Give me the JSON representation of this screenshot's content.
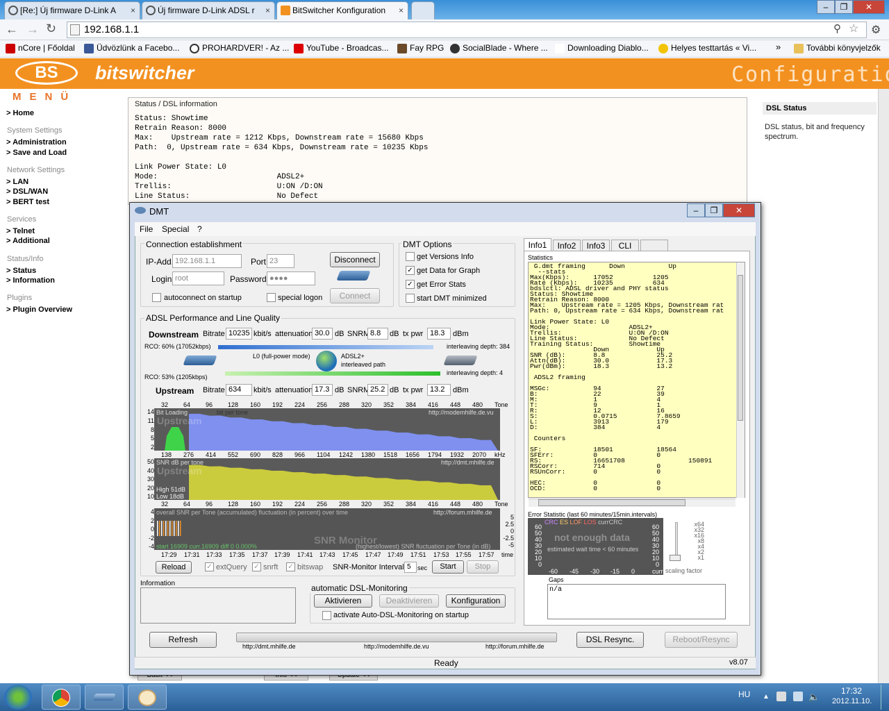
{
  "browser": {
    "tabs": [
      {
        "label": "[Re:] Új firmware D-Link A"
      },
      {
        "label": "Új firmware D-Link ADSL r"
      },
      {
        "label": "BitSwitcher Konfiguration"
      }
    ],
    "url": "192.168.1.1",
    "bookmarks": [
      {
        "label": "nCore | Főoldal"
      },
      {
        "label": "Üdvözlünk a Facebo..."
      },
      {
        "label": "PROHARDVER! - Az ..."
      },
      {
        "label": "YouTube - Broadcas..."
      },
      {
        "label": "Fay RPG"
      },
      {
        "label": "SocialBlade - Where ..."
      },
      {
        "label": "Downloading Diablo..."
      },
      {
        "label": "Helyes testtartás « Vi..."
      },
      {
        "label": "További könyvjelzők"
      }
    ]
  },
  "page": {
    "logo": "BS",
    "brand": "bitswitcher",
    "header_title": "Configuration",
    "menu_title": "MENÜ",
    "nav": {
      "home": "> Home",
      "system_settings": "System Settings",
      "administration": "> Administration",
      "save_load": "> Save and Load",
      "network_settings": "Network Settings",
      "lan": "> LAN",
      "dsl_wan": "> DSL/WAN",
      "bert": "> BERT test",
      "services": "Services",
      "telnet": "> Telnet",
      "additional": "> Additional",
      "status_info": "Status/Info",
      "status": "> Status",
      "information": "> Information",
      "plugins": "Plugins",
      "plugin_overview": "> Plugin Overview"
    },
    "status_heading": "Status / DSL information",
    "status_lines": "Status: Showtime\nRetrain Reason: 8000\nMax:    Upstream rate = 1212 Kbps, Downstream rate = 15680 Kbps\nPath:  0, Upstream rate = 634 Kbps, Downstream rate = 10235 Kbps\n\nLink Power State: L0\nMode:                          ADSL2+\nTrellis:                       U:ON /D:ON\nLine Status:                   No Defect",
    "right_heading": "DSL Status",
    "right_desc": "DSL status, bit and frequency spectrum.",
    "bottom_buttons": [
      "Back <<",
      "Info <<",
      "Update <<"
    ]
  },
  "dmt": {
    "title": "DMT",
    "menu": [
      "File",
      "Special",
      "?"
    ],
    "connection": {
      "group": "Connection establishment",
      "ip_label": "IP-Add.",
      "ip_value": "192.168.1.1",
      "port_label": "Port",
      "port_value": "23",
      "login_label": "Login",
      "login_value": "root",
      "password_label": "Password",
      "password_value": "●●●●",
      "disconnect": "Disconnect",
      "connect": "Connect",
      "autoconnect": "autoconnect on startup",
      "special_logon": "special logon"
    },
    "options": {
      "group": "DMT Options",
      "versions": "get Versions Info",
      "data_graph": "get Data for Graph",
      "error_stats": "get Error Stats",
      "minimized": "start DMT minimized"
    },
    "perf": {
      "group": "ADSL Performance and Line Quality",
      "downstream": "Downstream",
      "upstream": "Upstream",
      "bitrate": "Bitrate",
      "kbits": "kbit/s",
      "attenuation": "attenuation",
      "db": "dB",
      "snrm": "SNRM",
      "txpwr": "tx pwr",
      "dbm": "dBm",
      "down_bitrate": "10235",
      "down_att": "30.0",
      "down_snrm": "8.8",
      "down_txpwr": "18.3",
      "up_bitrate": "634",
      "up_att": "17.3",
      "up_snrm": "25.2",
      "up_txpwr": "13.2",
      "rco_down": "RCO: 60% (17052kbps)",
      "rco_up": "RCO: 53% (1205kbps)",
      "power_mode": "L0 (full-power mode)",
      "adsl_mode": "ADSL2+",
      "path": "interleaved path",
      "il_down": "interleaving depth: 384",
      "il_up": "interleaving depth: 4"
    },
    "charts": {
      "tone_ticks": [
        "32",
        "64",
        "96",
        "128",
        "160",
        "192",
        "224",
        "256",
        "288",
        "320",
        "352",
        "384",
        "416",
        "448",
        "480",
        "Tone"
      ],
      "khz_ticks": [
        "138",
        "276",
        "414",
        "552",
        "690",
        "828",
        "966",
        "1104",
        "1242",
        "1380",
        "1518",
        "1656",
        "1794",
        "1932",
        "2070",
        "kHz"
      ],
      "time_ticks": [
        "17:29",
        "17:31",
        "17:33",
        "17:35",
        "17:37",
        "17:39",
        "17:41",
        "17:43",
        "17:45",
        "17:47",
        "17:49",
        "17:51",
        "17:53",
        "17:55",
        "17:57",
        "time"
      ],
      "bit_label": "Bit Loading",
      "bit_sub": "bit per tone",
      "bit_url": "http://modemhilfe.de.vu",
      "bit_watermark": "Upstream",
      "snr_label": "SNR  dB per tone",
      "snr_url": "http://dmt.mhilfe.de",
      "snr_watermark": "Upstream",
      "snr_high": "High 51dB",
      "snr_low": "Low  18dB",
      "mon_label": "overall SNR per Tone (accumulated) fluctuation (in percent) over time",
      "mon_url": "http://forum.mhilfe.de",
      "mon_watermark": "SNR Monitor",
      "mon_footer": "start 16909  curr.16909  diff   0          0.000%",
      "mon_footer2": "(highest/lowest) SNR fluctuation per Tone (in dB)",
      "bit_y": [
        "14",
        "11",
        "8",
        "5",
        "2"
      ],
      "snr_y": [
        "50",
        "40",
        "30",
        "20",
        "10"
      ],
      "mon_y": [
        "4",
        "2",
        "0",
        "-2",
        "-4"
      ],
      "mon_y2": [
        "5",
        "2.5",
        "0",
        "-2.5",
        "-5"
      ]
    },
    "controls": {
      "reload": "Reload",
      "extquery": "extQuery",
      "snrft": "snrft",
      "bitswap": "bitswap",
      "interval_label": "SNR-Monitor Interval:",
      "interval_value": "5",
      "sec": "sec",
      "start": "Start",
      "stop": "Stop"
    },
    "information_label": "Information",
    "auto": {
      "group": "automatic DSL-Monitoring",
      "activate": "Aktivieren",
      "deactivate": "Deaktivieren",
      "config": "Konfiguration",
      "startup": "activate Auto-DSL-Monitoring on startup"
    },
    "bottom": {
      "refresh": "Refresh",
      "resync": "DSL Resync.",
      "reboot": "Reboot/Resync",
      "link1": "http://dmt.mhilfe.de",
      "link2": "http://modemhilfe.de.vu",
      "link3": "http://forum.mhilfe.de",
      "status": "Ready",
      "version": "v8.07"
    },
    "tabs": [
      "Info1",
      "Info2",
      "Info3",
      "CLI"
    ],
    "statistics_label": "Statistics",
    "stats_text": " G.dmt framing      Down           Up\n  --stats\nMax(Kbps):      17052          1205\nRate (Kbps):    10235          634\nbdslctl: ADSL driver and PHY status\nStatus: Showtime\nRetrain Reason: 8000\nMax:    Upstream rate = 1205 Kbps, Downstream rat\nPath: 0, Upstream rate = 634 Kbps, Downstream rat\n\nLink Power State: L0\nMode:                    ADSL2+\nTrellis:                 U:ON /D:ON\nLine Status:             No Defect\nTraining Status:         Showtime\n                Down            Up\nSNR (dB):       8.8             25.2\nAttn(dB):       30.0            17.3\nPwr(dBm):       18.3            13.2\n\n ADSL2 framing\n\nMSGc:           94              27\nB:              22              39\nM:              1               4\nT:              9               1\nR:              12              16\nS:              0.0715          7.8659\nL:              3913            179\nD:              384             4\n\n Counters\n\nSF:             18501           18564\nSFErr:          0               0\nRS:             16651708                150891\nRSCorr:         714             0\nRSUnCorr:       0               0\n\nHEC:            0               0\nOCD:            0               0",
    "err_label": "Error Statistic (last 60 minutes/15min.intervals)",
    "err_legend": [
      "CRC",
      "ES",
      "LOF",
      "LOS",
      "currCRC"
    ],
    "err_nodata": "not enough data",
    "err_wait": "estimated wait time < 60 minutes",
    "err_y": [
      "60",
      "50",
      "40",
      "30",
      "20",
      "10",
      "0"
    ],
    "err_x": [
      "-60",
      "-45",
      "-30",
      "-15",
      "0",
      "curr"
    ],
    "scale_ticks": [
      "x64",
      "x32",
      "x16",
      "x8",
      "x4",
      "x2",
      "x1"
    ],
    "scaling_label": "scaling factor",
    "gaps_label": "Gaps",
    "gaps_value": "n/a"
  },
  "taskbar": {
    "lang": "HU",
    "time": "17:32",
    "date": "2012.11.10."
  }
}
